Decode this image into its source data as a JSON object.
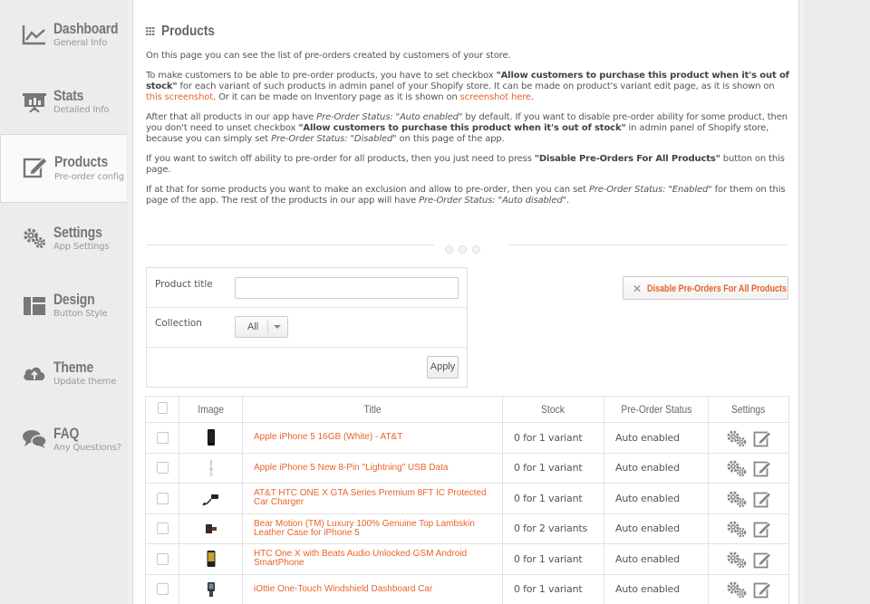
{
  "sidebar": {
    "items": [
      {
        "title": "Dashboard",
        "subtitle": "General Info",
        "icon": "chart-line-icon"
      },
      {
        "title": "Stats",
        "subtitle": "Detailed Info",
        "icon": "presentation-board-icon"
      },
      {
        "title": "Products",
        "subtitle": "Pre-order config",
        "icon": "edit-icon",
        "active": true
      },
      {
        "title": "Settings",
        "subtitle": "App Settings",
        "icon": "gears-icon"
      },
      {
        "title": "Design",
        "subtitle": "Button Style",
        "icon": "layout-icon"
      },
      {
        "title": "Theme",
        "subtitle": "Update theme",
        "icon": "cloud-upload-icon"
      },
      {
        "title": "FAQ",
        "subtitle": "Any Questions?",
        "icon": "chat-bubbles-icon"
      }
    ]
  },
  "page": {
    "title": "Products",
    "intro1": "On this page you can see the list of pre-orders created by customers of your store.",
    "intro2_a": "To make customers to be able to pre-order products, you have to set checkbox ",
    "intro2_b": "\"Allow customers to purchase this product when it's out of stock\"",
    "intro2_c": " for each variant of such products in admin panel of your Shopify store. It can be made on product's variant edit page, as it is shown on ",
    "intro2_link1": "this screenshot",
    "intro2_d": ". Or it can be made on Inventory page as it is shown on ",
    "intro2_link2": "screenshot here",
    "intro2_e": ".",
    "intro3_a": "After that all products in our app have ",
    "intro3_b": "Pre-Order Status: \"Auto enabled\"",
    "intro3_c": " by default. If you want to disable pre-order ability for some product, then you don't need to unset checkbox ",
    "intro3_d": "\"Allow customers to purchase this product when it's out of stock\"",
    "intro3_e": " in admin panel of Shopify store, because you can simply set ",
    "intro3_f": "Pre-Order Status: \"Disabled\"",
    "intro3_g": " on this page of the app.",
    "intro4_a": "If you want to switch off ability to pre-order for all products, then you just need to press ",
    "intro4_b": "\"Disable Pre-Orders For All Products\"",
    "intro4_c": " button on this page.",
    "intro5_a": "If at that for some products you want to make an exclusion and allow to pre-order, then you can set ",
    "intro5_b": "Pre-Order Status: \"Enabled\"",
    "intro5_c": " for them on this page of the app. The rest of the products in our app will have ",
    "intro5_d": "Pre-Order Status: \"Auto disabled\"",
    "intro5_e": "."
  },
  "filter": {
    "product_title_label": "Product title",
    "product_title_value": "",
    "collection_label": "Collection",
    "collection_value": "All",
    "apply_label": "Apply"
  },
  "disable_button_label": "Disable Pre-Orders For All Products",
  "table": {
    "headers": [
      "",
      "Image",
      "Title",
      "Stock",
      "Pre-Order Status",
      "Settings"
    ],
    "rows": [
      {
        "title": "Apple iPhone 5 16GB (White) - AT&T",
        "stock": "0 for 1 variant",
        "status": "Auto enabled"
      },
      {
        "title": "Apple iPhone 5 New 8-Pin \"Lightning\" USB Data",
        "stock": "0 for 1 variant",
        "status": "Auto enabled"
      },
      {
        "title": "AT&T HTC ONE X GTA Series Premium 8FT IC Protected Car Charger",
        "stock": "0 for 1 variant",
        "status": "Auto enabled"
      },
      {
        "title": "Bear Motion (TM) Luxury 100% Genuine Top Lambskin Leather Case for iPhone 5",
        "stock": "0 for 2 variants",
        "status": "Auto enabled"
      },
      {
        "title": "HTC One X with Beats Audio Unlocked GSM Android SmartPhone",
        "stock": "0 for 1 variant",
        "status": "Auto enabled"
      },
      {
        "title": "iOttie One-Touch Windshield Dashboard Car",
        "stock": "0 for 1 variant",
        "status": "Auto enabled"
      }
    ]
  },
  "colors": {
    "accent": "#e8632a",
    "sidebar_bg": "#ececec",
    "panel_bg": "#ffffff"
  }
}
